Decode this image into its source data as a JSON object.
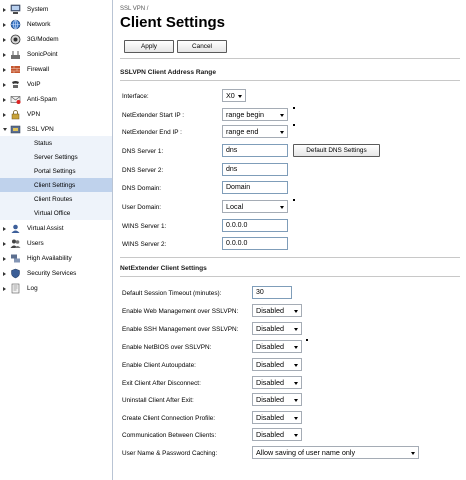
{
  "sidebar": {
    "items": [
      {
        "label": "System",
        "icon": "computer-icon"
      },
      {
        "label": "Network",
        "icon": "globe-icon"
      },
      {
        "label": "3G/Modem",
        "icon": "modem-icon"
      },
      {
        "label": "SonicPoint",
        "icon": "access-point-icon"
      },
      {
        "label": "Firewall",
        "icon": "firewall-icon"
      },
      {
        "label": "VoIP",
        "icon": "phone-icon"
      },
      {
        "label": "Anti-Spam",
        "icon": "anti-spam-icon"
      },
      {
        "label": "VPN",
        "icon": "vpn-icon"
      },
      {
        "label": "SSL VPN",
        "icon": "ssl-vpn-icon"
      }
    ],
    "ssl_vpn_subitems": [
      {
        "label": "Status"
      },
      {
        "label": "Server Settings"
      },
      {
        "label": "Portal Settings"
      },
      {
        "label": "Client Settings"
      },
      {
        "label": "Client Routes"
      },
      {
        "label": "Virtual Office"
      }
    ],
    "items_after": [
      {
        "label": "Virtual Assist",
        "icon": "virtual-assist-icon"
      },
      {
        "label": "Users",
        "icon": "users-icon"
      },
      {
        "label": "High Availability",
        "icon": "high-availability-icon"
      },
      {
        "label": "Security Services",
        "icon": "shield-icon"
      },
      {
        "label": "Log",
        "icon": "log-icon"
      }
    ]
  },
  "header": {
    "breadcrumb": "SSL VPN /",
    "title": "Client Settings",
    "apply_label": "Apply",
    "cancel_label": "Cancel"
  },
  "address_range": {
    "section_title": "SSLVPN Client Address Range",
    "interface_label": "Interface:",
    "interface_value": "X0",
    "start_ip_label": "NetExtender Start IP :",
    "start_ip_value": "range begin",
    "end_ip_label": "NetExtender End IP :",
    "end_ip_value": "range end",
    "dns1_label": "DNS Server 1:",
    "dns1_value": "dns",
    "default_dns_label": "Default DNS Settings",
    "dns2_label": "DNS Server 2:",
    "dns2_value": "dns",
    "dns_domain_label": "DNS Domain:",
    "dns_domain_value": "Domain",
    "user_domain_label": "User Domain:",
    "user_domain_value": "Local",
    "wins1_label": "WINS Server 1:",
    "wins1_value": "0.0.0.0",
    "wins2_label": "WINS Server 2:",
    "wins2_value": "0.0.0.0"
  },
  "client_settings": {
    "section_title": "NetExtender Client Settings",
    "timeout_label": "Default Session Timeout (minutes):",
    "timeout_value": "30",
    "web_mgmt_label": "Enable Web Management over SSLVPN:",
    "web_mgmt_value": "Disabled",
    "ssh_mgmt_label": "Enable SSH Management over SSLVPN:",
    "ssh_mgmt_value": "Disabled",
    "netbios_label": "Enable NetBIOS over SSLVPN:",
    "netbios_value": "Disabled",
    "autoupdate_label": "Enable Client Autoupdate:",
    "autoupdate_value": "Disabled",
    "exit_label": "Exit Client After Disconnect:",
    "exit_value": "Disabled",
    "uninstall_label": "Uninstall Client After Exit:",
    "uninstall_value": "Disabled",
    "profile_label": "Create Client Connection Profile:",
    "profile_value": "Disabled",
    "comm_label": "Communication Between Clients:",
    "comm_value": "Disabled",
    "caching_label": "User Name & Password Caching:",
    "caching_value": "Allow saving of user name only"
  },
  "colors": {
    "sidebar_active": "#bfd2ec",
    "sidebar_sub_bg": "#eef3fa",
    "field_border": "#7f9db9"
  }
}
